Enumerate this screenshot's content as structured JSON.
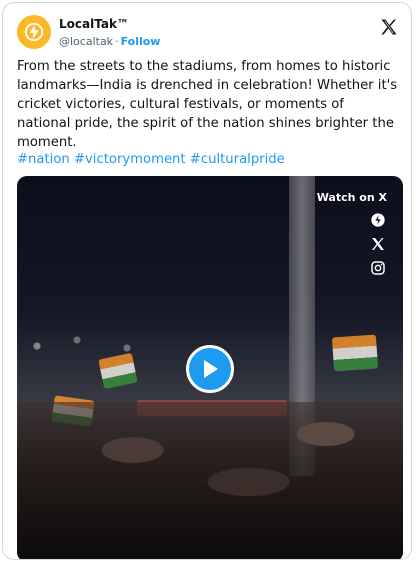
{
  "account": {
    "name": "LocalTak™",
    "handle": "@localtak",
    "separator": "·",
    "follow_label": "Follow",
    "avatar_icon": "lightning-bolt-icon",
    "brand_color": "#fbb829"
  },
  "platform": {
    "logo_icon": "x-logo-icon"
  },
  "tweet": {
    "text": "From the streets to the stadiums, from homes to historic landmarks—India is drenched in celebration! Whether it's cricket victories, cultural festivals, or moments of national pride, the spirit of the nation shines brighter the moment.",
    "hashtags": [
      "#nation",
      "#victorymoment",
      "#culturalpride"
    ]
  },
  "media": {
    "type": "video",
    "watch_label": "Watch on X",
    "play_icon": "play-icon",
    "side_icons": [
      "localtak-logo-icon",
      "x-logo-icon",
      "instagram-icon"
    ],
    "accent_color": "#1d9bf0"
  }
}
